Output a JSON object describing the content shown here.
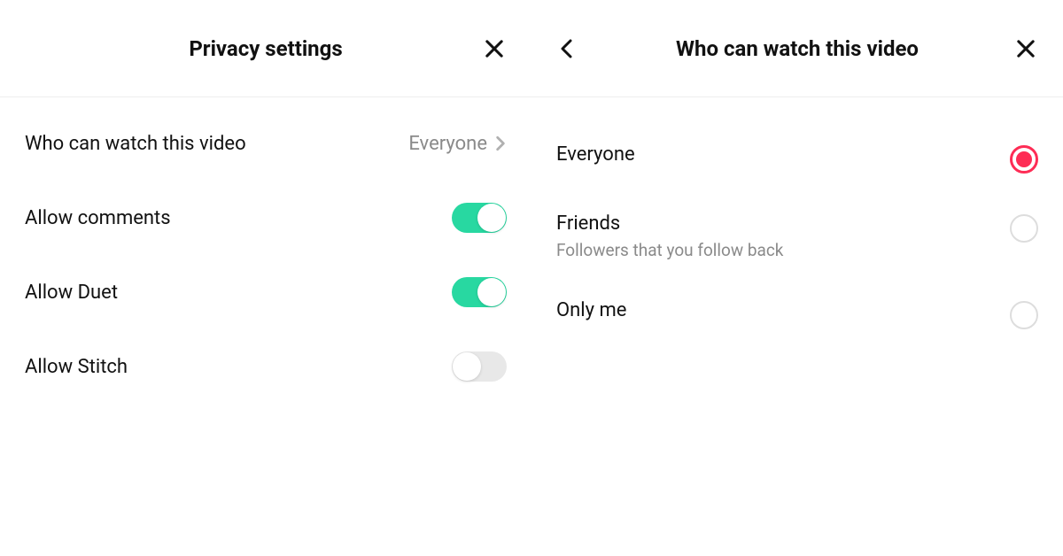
{
  "left": {
    "title": "Privacy settings",
    "rows": {
      "who": {
        "label": "Who can watch this video",
        "value": "Everyone"
      },
      "comments": {
        "label": "Allow comments",
        "on": true
      },
      "duet": {
        "label": "Allow Duet",
        "on": true
      },
      "stitch": {
        "label": "Allow Stitch",
        "on": false
      }
    }
  },
  "right": {
    "title": "Who can watch this video",
    "options": {
      "everyone": {
        "label": "Everyone",
        "selected": true
      },
      "friends": {
        "label": "Friends",
        "sub": "Followers that you follow back",
        "selected": false
      },
      "onlyme": {
        "label": "Only me",
        "selected": false
      }
    }
  }
}
